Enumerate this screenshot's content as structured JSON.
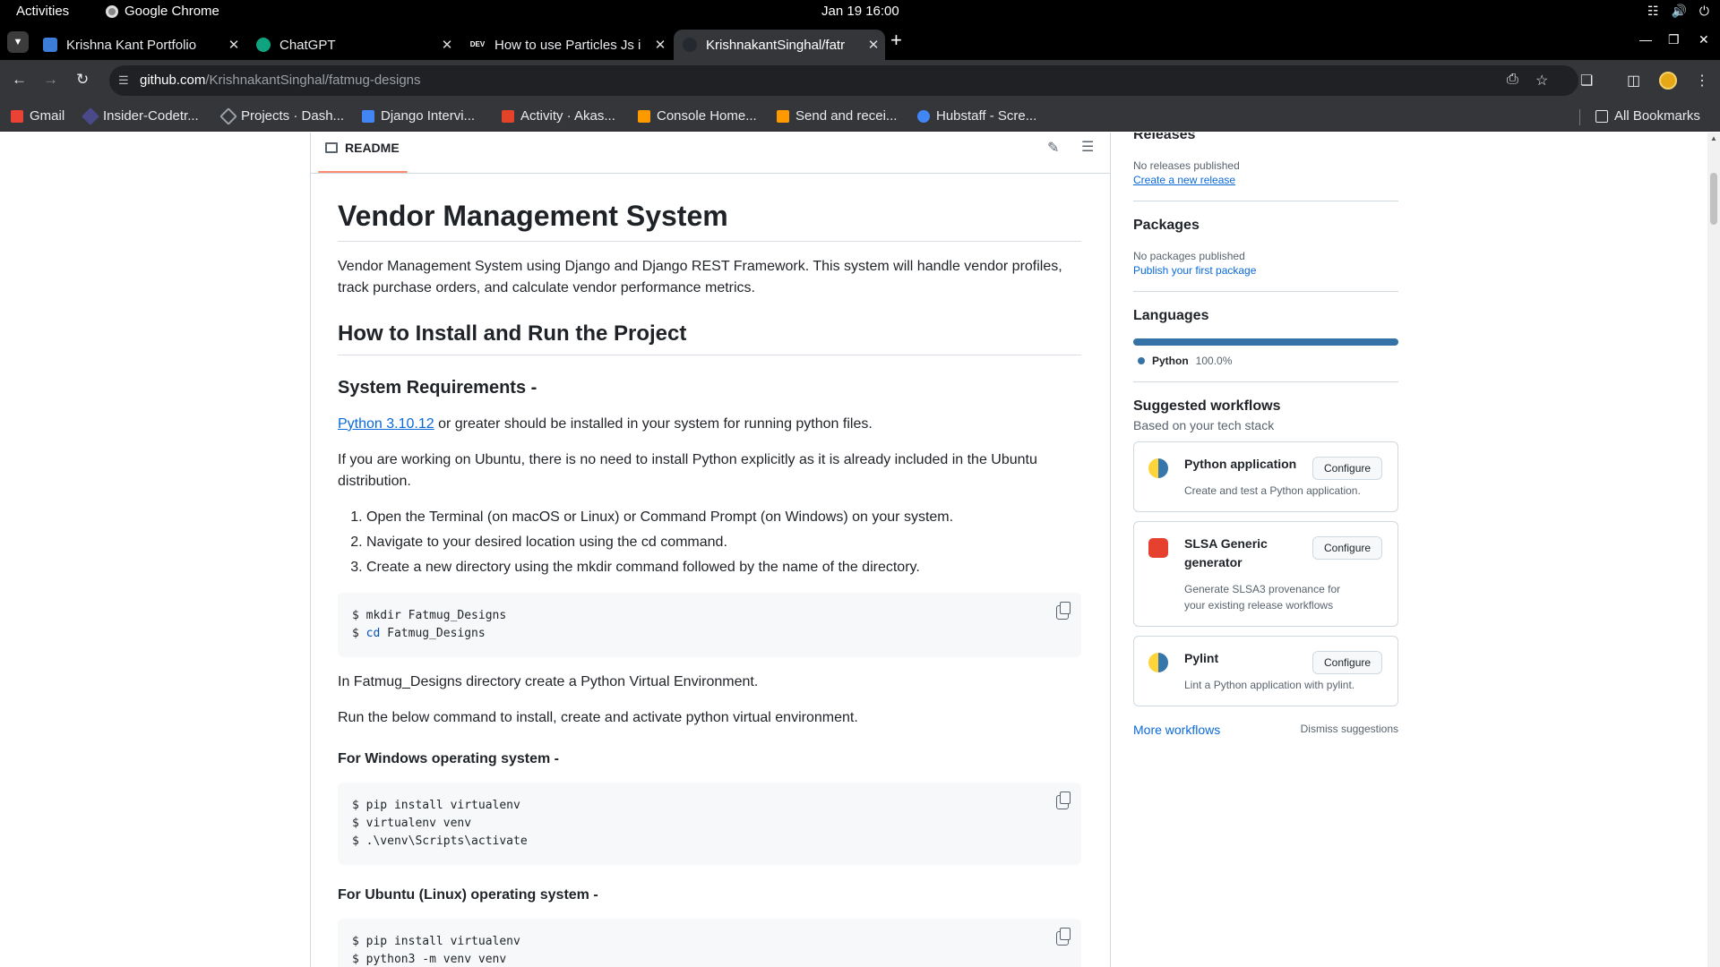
{
  "system": {
    "activities": "Activities",
    "app": "Google Chrome",
    "clock": "Jan 19  16:00"
  },
  "tabs": [
    {
      "title": "Krishna Kant Portfolio",
      "color": "#3b7dd8"
    },
    {
      "title": "ChatGPT",
      "color": "#10a37f"
    },
    {
      "title": "How to use Particles Js i",
      "color": "#000000",
      "fav_text": "DEV"
    },
    {
      "title": "KrishnakantSinghal/fatr",
      "color": "#24292f"
    }
  ],
  "toolbar": {
    "url_host": "github.com",
    "url_path": "/KrishnakantSinghal/fatmug-designs"
  },
  "bookmarks": [
    {
      "label": "Gmail",
      "color": "#ea4335"
    },
    {
      "label": "Insider-Codetr...",
      "color": "#4a4a8a"
    },
    {
      "label": "Projects · Dash...",
      "color": "#1a1a2e"
    },
    {
      "label": "Django Intervi...",
      "color": "#4285f4"
    },
    {
      "label": "Activity · Akas...",
      "color": "#e24329"
    },
    {
      "label": "Console Home...",
      "color": "#ff9900"
    },
    {
      "label": "Send and recei...",
      "color": "#ff9900"
    },
    {
      "label": "Hubstaff - Scre...",
      "color": "#4285f4"
    }
  ],
  "all_bookmarks": "All Bookmarks",
  "readme": {
    "tab_label": "README",
    "h1": "Vendor Management System",
    "intro": "Vendor Management System using Django and Django REST Framework. This system will handle vendor profiles, track purchase orders, and calculate vendor performance metrics.",
    "h2_install": "How to Install and Run the Project",
    "h3_requirements": "System Requirements -",
    "python_link": "Python 3.10.12",
    "python_req_rest": " or greater should be installed in your system for running python files.",
    "ubuntu_note": "If you are working on Ubuntu, there is no need to install Python explicitly as it is already included in the Ubuntu distribution.",
    "steps": [
      "Open the Terminal (on macOS or Linux) or Command Prompt (on Windows) on your system.",
      "Navigate to your desired location using the cd command.",
      "Create a new directory using the mkdir command followed by the name of the directory."
    ],
    "code1": {
      "line1": "$ mkdir Fatmug_Designs",
      "line2_prefix": "$ ",
      "line2_kw": "cd",
      "line2_rest": " Fatmug_Designs"
    },
    "venv_note": "In Fatmug_Designs directory create a Python Virtual Environment.",
    "run_note": "Run the below command to install, create and activate python virtual environment.",
    "h4_windows": "For Windows operating system -",
    "code2": [
      "$ pip install virtualenv",
      "$ virtualenv venv",
      "$ .\\venv\\Scripts\\activate"
    ],
    "h4_ubuntu": "For Ubuntu (Linux) operating system -",
    "code3": [
      "$ pip install virtualenv",
      "$ python3 -m venv venv"
    ]
  },
  "sidebar": {
    "releases_title": "Releases",
    "releases_none": "No releases published",
    "releases_link": "Create a new release",
    "packages_title": "Packages",
    "packages_none": "No packages published",
    "packages_link": "Publish your first package",
    "languages_title": "Languages",
    "language": {
      "name": "Python",
      "percent": "100.0%",
      "color": "#3572a5"
    },
    "workflows_title": "Suggested workflows",
    "workflows_sub": "Based on your tech stack",
    "workflows": [
      {
        "name": "Python application",
        "desc": "Create and test a Python application.",
        "button": "Configure"
      },
      {
        "name": "SLSA Generic generator",
        "desc": "Generate SLSA3 provenance for your existing release workflows",
        "button": "Configure"
      },
      {
        "name": "Pylint",
        "desc": "Lint a Python application with pylint.",
        "button": "Configure"
      }
    ],
    "more_workflows": "More workflows",
    "dismiss": "Dismiss suggestions"
  }
}
